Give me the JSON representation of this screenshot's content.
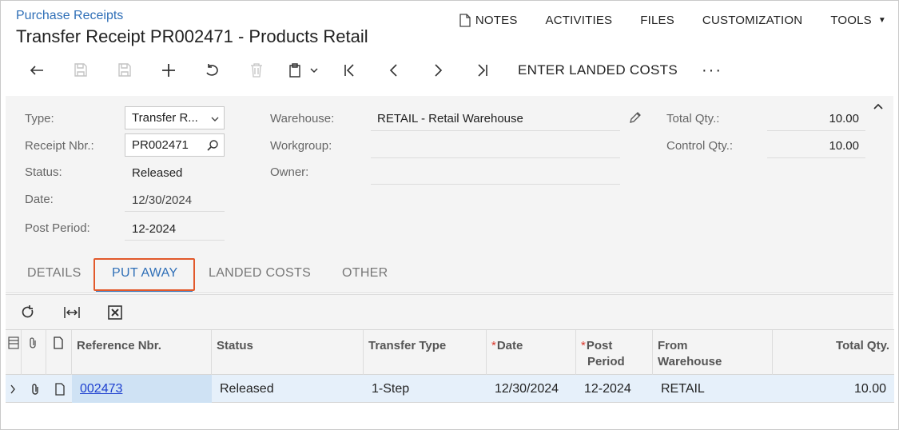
{
  "header": {
    "breadcrumb": "Purchase Receipts",
    "title": "Transfer Receipt PR002471 - Products Retail"
  },
  "top_menu": {
    "notes": "NOTES",
    "activities": "ACTIVITIES",
    "files": "FILES",
    "customization": "CUSTOMIZATION",
    "tools": "TOOLS"
  },
  "toolbar": {
    "enter_landed_costs": "ENTER LANDED COSTS",
    "more": "···"
  },
  "form": {
    "type_label": "Type:",
    "type_value": "Transfer R...",
    "receipt_nbr_label": "Receipt Nbr.:",
    "receipt_nbr_value": "PR002471",
    "status_label": "Status:",
    "status_value": "Released",
    "date_label": "Date:",
    "date_value": "12/30/2024",
    "post_period_label": "Post Period:",
    "post_period_value": "12-2024",
    "warehouse_label": "Warehouse:",
    "warehouse_value": "RETAIL - Retail Warehouse",
    "workgroup_label": "Workgroup:",
    "workgroup_value": "",
    "owner_label": "Owner:",
    "owner_value": "",
    "total_qty_label": "Total Qty.:",
    "total_qty_value": "10.00",
    "control_qty_label": "Control Qty.:",
    "control_qty_value": "10.00"
  },
  "tabs": [
    {
      "label": "DETAILS"
    },
    {
      "label": "PUT AWAY"
    },
    {
      "label": "LANDED COSTS"
    },
    {
      "label": "OTHER"
    }
  ],
  "active_tab": "PUT AWAY",
  "grid": {
    "columns": {
      "reference_nbr": "Reference Nbr.",
      "status": "Status",
      "transfer_type": "Transfer Type",
      "date": "Date",
      "post_period_1": "Post",
      "post_period_2": "Period",
      "from_warehouse_1": "From",
      "from_warehouse_2": "Warehouse",
      "total_qty": "Total Qty."
    },
    "rows": [
      {
        "reference_nbr": "002473",
        "status": "Released",
        "transfer_type": "1-Step",
        "date": "12/30/2024",
        "post_period": "12-2024",
        "from_warehouse": "RETAIL",
        "total_qty": "10.00"
      }
    ]
  },
  "colors": {
    "accent": "#2f6fb7",
    "highlight": "#e2592b",
    "required": "#d9362b",
    "link": "#1d3fcf",
    "selected_row": "#e6f0fa"
  }
}
